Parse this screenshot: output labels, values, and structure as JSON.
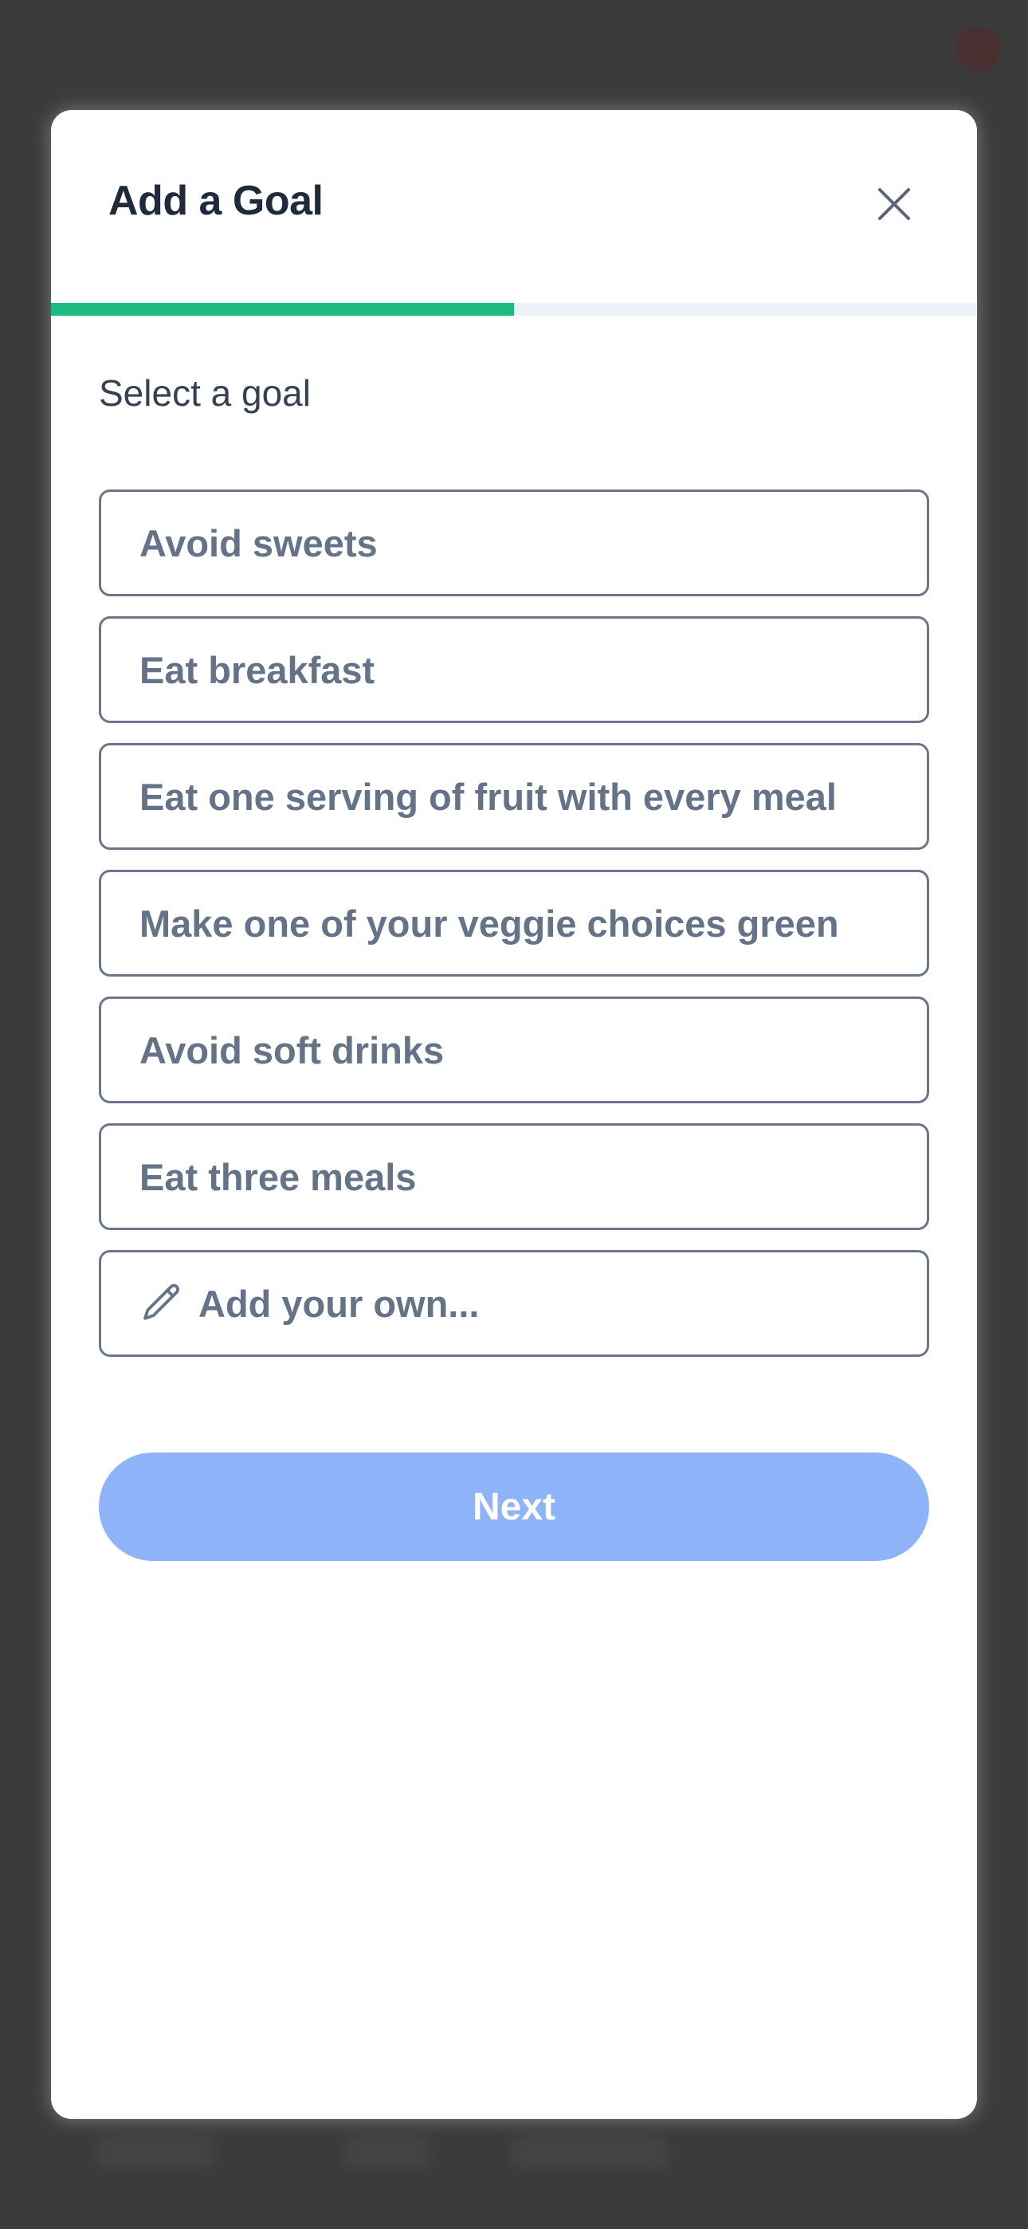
{
  "modal": {
    "title": "Add a Goal",
    "close_icon": "close-icon",
    "progress": 0.5,
    "section_label": "Select a goal"
  },
  "goals": [
    {
      "label": "Avoid sweets"
    },
    {
      "label": "Eat breakfast"
    },
    {
      "label": "Eat one serving of fruit with every meal"
    },
    {
      "label": "Make one of your veggie choices green"
    },
    {
      "label": "Avoid soft drinks"
    },
    {
      "label": "Eat three meals"
    }
  ],
  "custom_goal": {
    "icon": "pencil-icon",
    "label": "Add your own..."
  },
  "next_button": {
    "label": "Next",
    "state": "disabled"
  },
  "colors": {
    "progress": "#1dbb82",
    "next_button": "#8eb3f8",
    "option_text": "#657389",
    "title": "#1f2a3a"
  }
}
